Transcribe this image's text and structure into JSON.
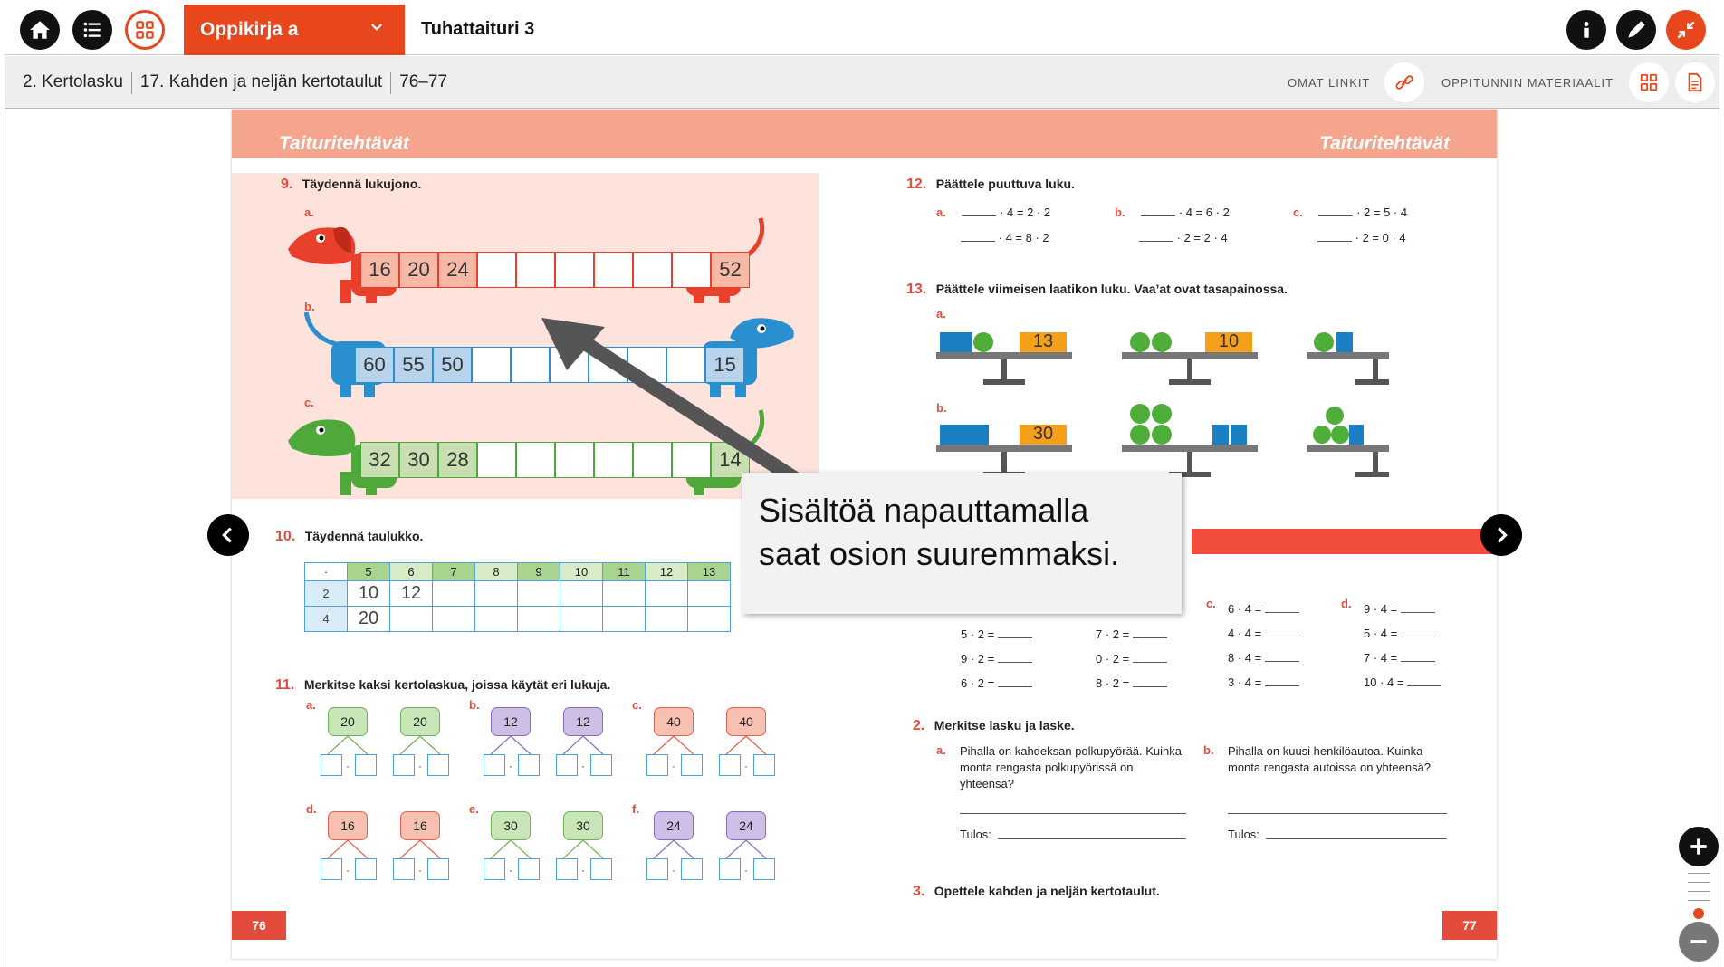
{
  "toolbar": {
    "book_select": "Oppikirja a",
    "book_title": "Tuhattaituri 3"
  },
  "breadcrumb": {
    "chapter": "2. Kertolasku",
    "lesson": "17. Kahden ja neljän kertotaulut",
    "pages": "76–77",
    "own_links": "OMAT LINKIT",
    "lesson_materials": "OPPITUNNIN MATERIAALIT"
  },
  "page": {
    "band_left": "Taituritehtävät",
    "band_right": "Taituritehtävät",
    "left_page_number": "76",
    "right_page_number": "77"
  },
  "ex9": {
    "num": "9.",
    "title": "Täydennä lukujono.",
    "a_label": "a.",
    "a_values": [
      "16",
      "20",
      "24",
      "",
      "",
      "",
      "",
      "",
      "",
      "52"
    ],
    "b_label": "b.",
    "b_values": [
      "60",
      "55",
      "50",
      "",
      "",
      "",
      "",
      "",
      "",
      "15"
    ],
    "c_label": "c.",
    "c_values": [
      "32",
      "30",
      "28",
      "",
      "",
      "",
      "",
      "",
      "",
      "14"
    ]
  },
  "ex10": {
    "num": "10.",
    "title": "Täydennä taulukko.",
    "header": [
      "·",
      "5",
      "6",
      "7",
      "8",
      "9",
      "10",
      "11",
      "12",
      "13"
    ],
    "row2": [
      "2",
      "10",
      "12"
    ],
    "row4": [
      "4",
      "20"
    ]
  },
  "ex11": {
    "num": "11.",
    "title": "Merkitse kaksi kertolaskua, joissa käytät eri lukuja.",
    "groups": [
      {
        "label": "a.",
        "value": "20"
      },
      {
        "label": "b.",
        "value": "12"
      },
      {
        "label": "c.",
        "value": "40"
      },
      {
        "label": "d.",
        "value": "16"
      },
      {
        "label": "e.",
        "value": "30"
      },
      {
        "label": "f.",
        "value": "24"
      }
    ]
  },
  "ex12": {
    "num": "12.",
    "title": "Päättele puuttuva luku.",
    "a_label": "a.",
    "a1": "· 4 = 2 · 2",
    "a2": "· 4 = 8 · 2",
    "b_label": "b.",
    "b1": "· 4 = 6 · 2",
    "b2": "· 2 = 2 · 4",
    "c_label": "c.",
    "c1": "· 2 = 5 · 4",
    "c2": "· 2 = 0 · 4"
  },
  "ex13": {
    "num": "13.",
    "title": "Päättele viimeisen laatikon luku. Vaa’at ovat tasapainossa.",
    "a_label": "a.",
    "a_vals": [
      "13",
      "10"
    ],
    "b_label": "b.",
    "b_vals": [
      "30"
    ]
  },
  "drill": {
    "col1": [
      "5 · 2 =",
      "9 · 2 =",
      "6 · 2 ="
    ],
    "col2": [
      "7 · 2 =",
      "0 · 2 =",
      "8 · 2 ="
    ],
    "c_label": "c.",
    "col3": [
      "6 · 4 =",
      "4 · 4 =",
      "8 · 4 =",
      "3 · 4 ="
    ],
    "d_label": "d.",
    "col4": [
      "9 · 4 =",
      "5 · 4 =",
      "7 · 4 =",
      "10 · 4 ="
    ]
  },
  "ex2": {
    "num": "2.",
    "title": "Merkitse lasku ja laske.",
    "a_label": "a.",
    "a_text": "Pihalla on kahdeksan polkupyörää. Kuinka monta rengasta polkupyörissä on yhteensä?",
    "b_label": "b.",
    "b_text": "Pihalla on kuusi henkilöautoa. Kuinka monta rengasta autoissa on yhteensä?",
    "result_a": "Tulos:",
    "result_b": "Tulos:"
  },
  "ex3": {
    "num": "3.",
    "title": "Opettele kahden ja neljän kertotaulut."
  },
  "tooltip": {
    "line1": "Sisältöä napauttamalla",
    "line2": "saat osion suuremmaksi."
  },
  "colors": {
    "accent": "#e8461d",
    "band": "#f5a58d",
    "exercise_number": "#e34b3d"
  }
}
